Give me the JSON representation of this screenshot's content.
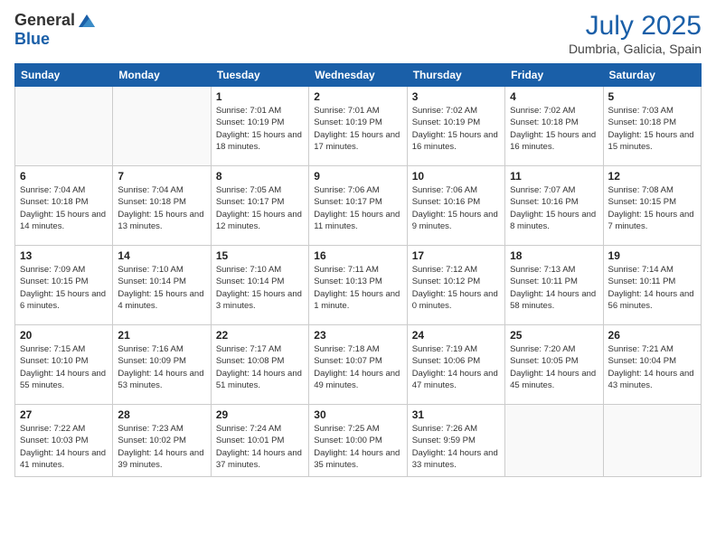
{
  "header": {
    "logo_general": "General",
    "logo_blue": "Blue",
    "month": "July 2025",
    "location": "Dumbria, Galicia, Spain"
  },
  "days_of_week": [
    "Sunday",
    "Monday",
    "Tuesday",
    "Wednesday",
    "Thursday",
    "Friday",
    "Saturday"
  ],
  "weeks": [
    [
      {
        "day": "",
        "info": ""
      },
      {
        "day": "",
        "info": ""
      },
      {
        "day": "1",
        "info": "Sunrise: 7:01 AM\nSunset: 10:19 PM\nDaylight: 15 hours and 18 minutes."
      },
      {
        "day": "2",
        "info": "Sunrise: 7:01 AM\nSunset: 10:19 PM\nDaylight: 15 hours and 17 minutes."
      },
      {
        "day": "3",
        "info": "Sunrise: 7:02 AM\nSunset: 10:19 PM\nDaylight: 15 hours and 16 minutes."
      },
      {
        "day": "4",
        "info": "Sunrise: 7:02 AM\nSunset: 10:18 PM\nDaylight: 15 hours and 16 minutes."
      },
      {
        "day": "5",
        "info": "Sunrise: 7:03 AM\nSunset: 10:18 PM\nDaylight: 15 hours and 15 minutes."
      }
    ],
    [
      {
        "day": "6",
        "info": "Sunrise: 7:04 AM\nSunset: 10:18 PM\nDaylight: 15 hours and 14 minutes."
      },
      {
        "day": "7",
        "info": "Sunrise: 7:04 AM\nSunset: 10:18 PM\nDaylight: 15 hours and 13 minutes."
      },
      {
        "day": "8",
        "info": "Sunrise: 7:05 AM\nSunset: 10:17 PM\nDaylight: 15 hours and 12 minutes."
      },
      {
        "day": "9",
        "info": "Sunrise: 7:06 AM\nSunset: 10:17 PM\nDaylight: 15 hours and 11 minutes."
      },
      {
        "day": "10",
        "info": "Sunrise: 7:06 AM\nSunset: 10:16 PM\nDaylight: 15 hours and 9 minutes."
      },
      {
        "day": "11",
        "info": "Sunrise: 7:07 AM\nSunset: 10:16 PM\nDaylight: 15 hours and 8 minutes."
      },
      {
        "day": "12",
        "info": "Sunrise: 7:08 AM\nSunset: 10:15 PM\nDaylight: 15 hours and 7 minutes."
      }
    ],
    [
      {
        "day": "13",
        "info": "Sunrise: 7:09 AM\nSunset: 10:15 PM\nDaylight: 15 hours and 6 minutes."
      },
      {
        "day": "14",
        "info": "Sunrise: 7:10 AM\nSunset: 10:14 PM\nDaylight: 15 hours and 4 minutes."
      },
      {
        "day": "15",
        "info": "Sunrise: 7:10 AM\nSunset: 10:14 PM\nDaylight: 15 hours and 3 minutes."
      },
      {
        "day": "16",
        "info": "Sunrise: 7:11 AM\nSunset: 10:13 PM\nDaylight: 15 hours and 1 minute."
      },
      {
        "day": "17",
        "info": "Sunrise: 7:12 AM\nSunset: 10:12 PM\nDaylight: 15 hours and 0 minutes."
      },
      {
        "day": "18",
        "info": "Sunrise: 7:13 AM\nSunset: 10:11 PM\nDaylight: 14 hours and 58 minutes."
      },
      {
        "day": "19",
        "info": "Sunrise: 7:14 AM\nSunset: 10:11 PM\nDaylight: 14 hours and 56 minutes."
      }
    ],
    [
      {
        "day": "20",
        "info": "Sunrise: 7:15 AM\nSunset: 10:10 PM\nDaylight: 14 hours and 55 minutes."
      },
      {
        "day": "21",
        "info": "Sunrise: 7:16 AM\nSunset: 10:09 PM\nDaylight: 14 hours and 53 minutes."
      },
      {
        "day": "22",
        "info": "Sunrise: 7:17 AM\nSunset: 10:08 PM\nDaylight: 14 hours and 51 minutes."
      },
      {
        "day": "23",
        "info": "Sunrise: 7:18 AM\nSunset: 10:07 PM\nDaylight: 14 hours and 49 minutes."
      },
      {
        "day": "24",
        "info": "Sunrise: 7:19 AM\nSunset: 10:06 PM\nDaylight: 14 hours and 47 minutes."
      },
      {
        "day": "25",
        "info": "Sunrise: 7:20 AM\nSunset: 10:05 PM\nDaylight: 14 hours and 45 minutes."
      },
      {
        "day": "26",
        "info": "Sunrise: 7:21 AM\nSunset: 10:04 PM\nDaylight: 14 hours and 43 minutes."
      }
    ],
    [
      {
        "day": "27",
        "info": "Sunrise: 7:22 AM\nSunset: 10:03 PM\nDaylight: 14 hours and 41 minutes."
      },
      {
        "day": "28",
        "info": "Sunrise: 7:23 AM\nSunset: 10:02 PM\nDaylight: 14 hours and 39 minutes."
      },
      {
        "day": "29",
        "info": "Sunrise: 7:24 AM\nSunset: 10:01 PM\nDaylight: 14 hours and 37 minutes."
      },
      {
        "day": "30",
        "info": "Sunrise: 7:25 AM\nSunset: 10:00 PM\nDaylight: 14 hours and 35 minutes."
      },
      {
        "day": "31",
        "info": "Sunrise: 7:26 AM\nSunset: 9:59 PM\nDaylight: 14 hours and 33 minutes."
      },
      {
        "day": "",
        "info": ""
      },
      {
        "day": "",
        "info": ""
      }
    ]
  ]
}
